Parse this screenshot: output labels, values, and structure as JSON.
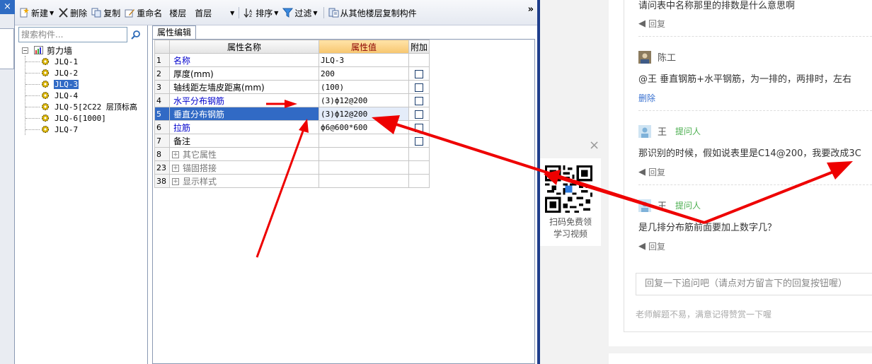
{
  "toolbar": {
    "new_label": "新建",
    "delete_label": "删除",
    "copy_label": "复制",
    "rename_label": "重命名",
    "floor_label": "楼层",
    "floor_value": "首层",
    "sort_label": "排序",
    "filter_label": "过滤",
    "copy_from_label": "从其他楼层复制构件",
    "more_label": "»"
  },
  "left_panel": {
    "search_placeholder": "搜索构件...",
    "tree_root": "剪力墙",
    "tree_items": [
      "JLQ-1",
      "JLQ-2",
      "JLQ-3",
      "JLQ-4",
      "JLQ-5[2C22 层顶标高",
      "JLQ-6[1000]",
      "JLQ-7"
    ],
    "selected_item": "JLQ-3"
  },
  "properties": {
    "tab_label": "属性编辑",
    "headers": {
      "name": "属性名称",
      "value": "属性值",
      "extra": "附加"
    },
    "rows": [
      {
        "num": "1",
        "name": "名称",
        "value": "JLQ-3"
      },
      {
        "num": "2",
        "name": "厚度(mm)",
        "value": "200"
      },
      {
        "num": "3",
        "name": "轴线距左墙皮距离(mm)",
        "value": "(100)"
      },
      {
        "num": "4",
        "name": "水平分布钢筋",
        "value": "(3)ф12@200"
      },
      {
        "num": "5",
        "name": "垂直分布钢筋",
        "value": "(3)ф12@200"
      },
      {
        "num": "6",
        "name": "拉筋",
        "value": "ф6@600*600"
      },
      {
        "num": "7",
        "name": "备注",
        "value": ""
      },
      {
        "num": "8",
        "name": "其它属性",
        "value": ""
      },
      {
        "num": "23",
        "name": "锚固搭接",
        "value": ""
      },
      {
        "num": "38",
        "name": "显示样式",
        "value": ""
      }
    ]
  },
  "qr": {
    "close_label": "×",
    "text_line1": "扫码免费领",
    "text_line2": "学习视频"
  },
  "comments": {
    "top_text": "请问表中名称那里的排数是什么意思啊",
    "reply_label": "回复",
    "user1": "陈工",
    "comment1": "@王  垂直钢筋+水平钢筋，为一排的，两排时，左右",
    "delete_label": "删除",
    "user2": "王",
    "asker_tag": "提问人",
    "comment2": "那识别的时候，假如说表里是C14@200，我要改成3C",
    "user3": "王",
    "comment3": "是几排分布筋前面要加上数字几？",
    "reply_placeholder": "回复一下追问吧（请点对方留言下的回复按钮喔）",
    "tip": "老师解题不易，满意记得赞赏一下喔"
  },
  "colors": {
    "selection": "#316ac5",
    "annotation_arrow": "#ee0000",
    "asker_tag": "#4caf50",
    "link": "#3b73d1"
  }
}
